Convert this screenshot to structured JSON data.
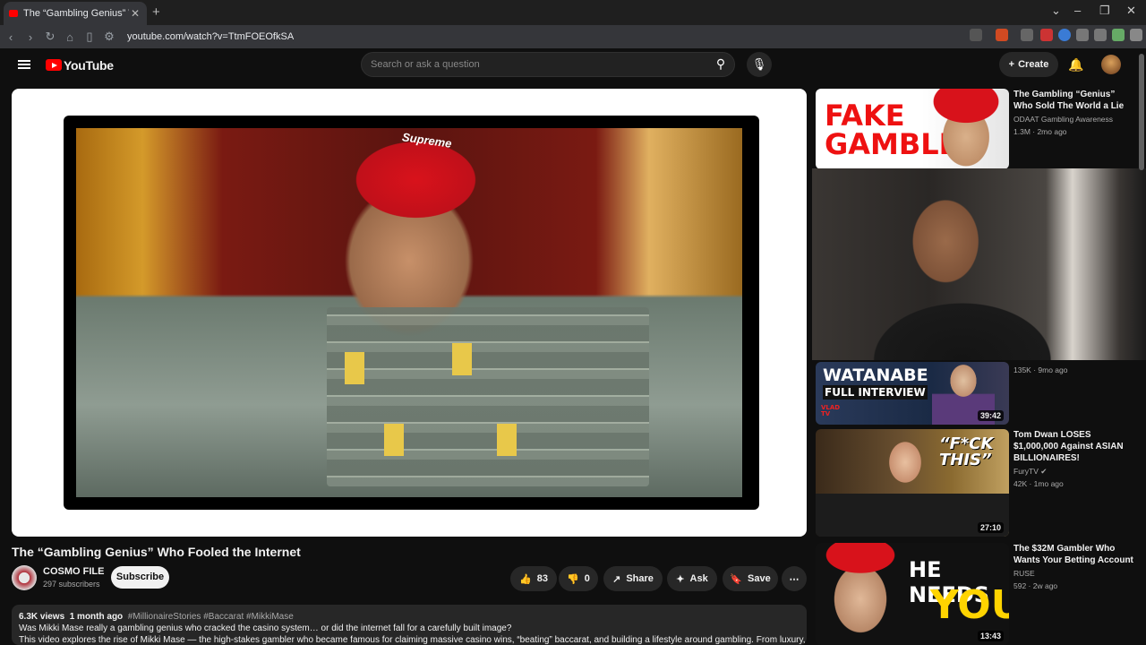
{
  "browser": {
    "tab_title": "The “Gambling Genius” Who Fo",
    "tab_close": "✕",
    "new_tab": "+",
    "url": "youtube.com/watch?v=TtmFOEOfkSA"
  },
  "header": {
    "logo_text": "YouTube",
    "search_placeholder": "Search or ask a question",
    "create_label": "Create"
  },
  "video": {
    "title": "The “Gambling Genius” Who Fooled the Internet",
    "channel": "COSMO FILE",
    "subscribers": "297 subscribers",
    "subscribe_label": "Subscribe",
    "likes": "83",
    "dislikes": "0",
    "share_label": "Share",
    "ask_label": "Ask",
    "save_label": "Save",
    "thumbnail_hat_text": "Supreme"
  },
  "description": {
    "views": "6.3K views",
    "age": "1 month ago",
    "tags": "#MillionaireStories #Baccarat #MikkiMase",
    "line1": "Was Mikki Mase really a gambling genius who cracked the casino system… or did the internet fall for a carefully built image?",
    "line2": "This video explores the rise of Mikki Mase — the high-stakes gambler who became famous for claiming massive casino wins, “beating” baccarat, and building a lifestyle around gambling. From luxury, millions"
  },
  "recommendations": [
    {
      "title": "The Gambling “Genius” Who Sold The World a Lie",
      "channel": "ODAAT Gambling Awareness",
      "meta": "1.3M · 2mo ago",
      "thumb_text": "FAKE GAMBLER"
    },
    {
      "meta": "135K · 9mo ago",
      "duration": "39:42",
      "thumb_text_1": "WATANABE",
      "thumb_text_2": "FULL INTERVIEW",
      "thumb_text_3": "VLAD TV"
    },
    {
      "title": "Tom Dwan LOSES $1,000,000 Against ASIAN BILLIONAIRES!",
      "channel": "FuryTV",
      "meta": "42K · 1mo ago",
      "duration": "27:10",
      "thumb_text": "“F*CK THIS”"
    },
    {
      "title": "The $32M Gambler Who Wants Your Betting Account",
      "channel": "RUSE",
      "meta": "592 · 2w ago",
      "duration": "13:43",
      "thumb_text_1": "HE NEEDS",
      "thumb_text_2": "YOU"
    }
  ]
}
